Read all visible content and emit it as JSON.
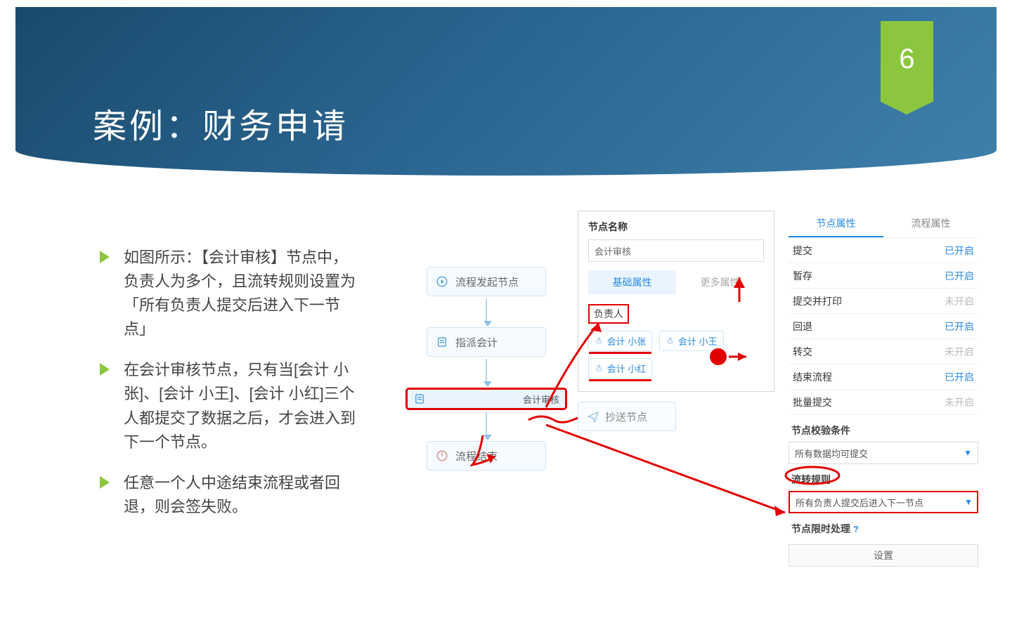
{
  "page_number": "6",
  "title": "案例：财务申请",
  "bullets": [
    "如图所示：【会计审核】节点中，负责人为多个，且流转规则设置为「所有负责人提交后进入下一节点」",
    "在会计审核节点，只有当[会计 小张]、[会计 小王]、[会计 小红]三个人都提交了数据之后，才会进入到下一个节点。",
    "任意一个人中途结束流程或者回退，则会签失败。"
  ],
  "flow": {
    "start": "流程发起节点",
    "assign": "指派会计",
    "review": "会计审核",
    "cc": "抄送节点",
    "end": "流程结束"
  },
  "panel": {
    "name_label": "节点名称",
    "name_value": "会计审核",
    "tab_basic": "基础属性",
    "tab_more": "更多属性",
    "owner_label": "负责人",
    "owners": [
      "会计 小张",
      "会计 小王",
      "会计 小红"
    ]
  },
  "rtabs": {
    "node": "节点属性",
    "flow": "流程属性"
  },
  "rrows": [
    {
      "k": "提交",
      "v": "已开启",
      "on": true
    },
    {
      "k": "暂存",
      "v": "已开启",
      "on": true
    },
    {
      "k": "提交并打印",
      "v": "未开启",
      "on": false
    },
    {
      "k": "回退",
      "v": "已开启",
      "on": true
    },
    {
      "k": "转交",
      "v": "未开启",
      "on": false
    },
    {
      "k": "结束流程",
      "v": "已开启",
      "on": true
    },
    {
      "k": "批量提交",
      "v": "未开启",
      "on": false
    }
  ],
  "sections": {
    "cond_title": "节点校验条件",
    "cond_value": "所有数据均可提交",
    "rule_title": "流转规则",
    "rule_value": "所有负责人提交后进入下一节点",
    "timeout_title": "节点限时处理",
    "set_btn": "设置"
  }
}
